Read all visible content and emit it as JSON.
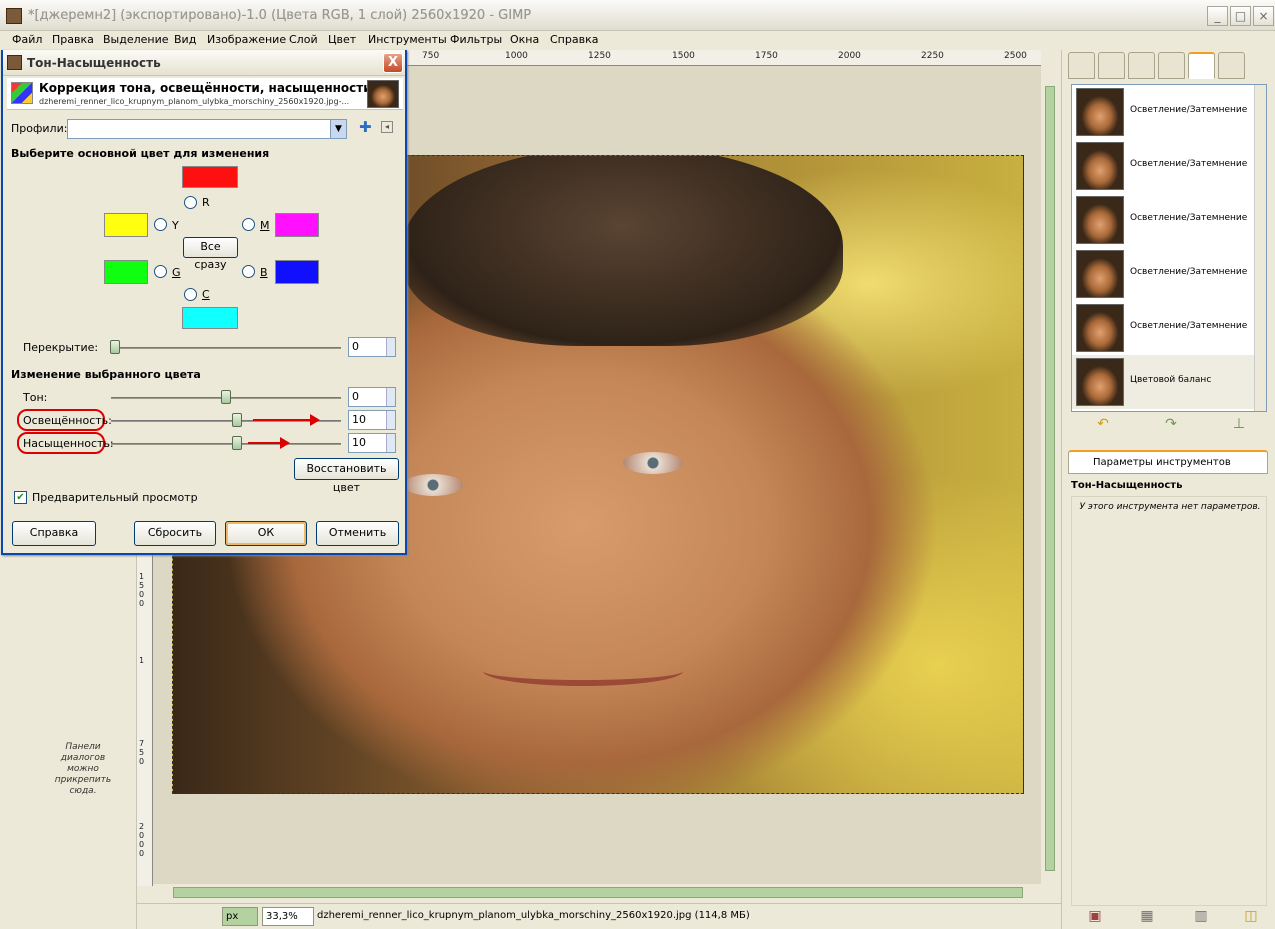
{
  "window": {
    "title": "*[джеремн2] (экспортировано)-1.0 (Цвета RGB, 1 слой) 2560x1920 - GIMP",
    "minimize": "_",
    "maximize": "□",
    "close": "×"
  },
  "menu": [
    "Файл",
    "Правка",
    "Выделение",
    "Вид",
    "Изображение",
    "Слой",
    "Цвет",
    "Инструменты",
    "Фильтры",
    "Окна",
    "Справка"
  ],
  "ruler_top": [
    "750",
    "1000",
    "1250",
    "1500",
    "1750",
    "2000",
    "2250",
    "2500"
  ],
  "ruler_left": [
    "1",
    "5",
    "0",
    "0",
    "1",
    "7",
    "5",
    "0",
    "2",
    "0",
    "0",
    "0"
  ],
  "left_dock_note": "Панели диалогов можно прикрепить сюда.",
  "status": {
    "unit": "px",
    "zoom": "33,3%",
    "file": "dzheremi_renner_lico_krupnym_planom_ulybka_morschiny_2560x1920.jpg (114,8 МБ)"
  },
  "history": {
    "items": [
      "Осветление/Затемнение",
      "Осветление/Затемнение",
      "Осветление/Затемнение",
      "Осветление/Затемнение",
      "Осветление/Затемнение",
      "Цветовой баланс"
    ]
  },
  "tool_options": {
    "tab_label": "Параметры инструментов",
    "tool_name": "Тон-Насыщенность",
    "note": "У этого инструмента нет параметров."
  },
  "dialog": {
    "title": "Тон-Насыщенность",
    "close": "X",
    "header_title": "Коррекция тона, освещённости, насыщенности",
    "header_file": "dzheremi_renner_lico_krupnym_planom_ulybka_morschiny_2560x1920.jpg-...",
    "profiles_label": "Профили:",
    "profiles_value": "",
    "add": "✚",
    "menu_arrow": "◂",
    "select_color_heading": "Выберите основной цвет для изменения",
    "colors": {
      "R": {
        "label": "R",
        "hex": "#ff1010"
      },
      "Y": {
        "label": "Y",
        "hex": "#ffff10"
      },
      "M": {
        "label": "M",
        "hex": "#ff10ff"
      },
      "G": {
        "label": "G",
        "hex": "#10ff10"
      },
      "B": {
        "label": "B",
        "hex": "#1010ff"
      },
      "C": {
        "label": "C",
        "hex": "#10ffff"
      }
    },
    "all_button": "Все сразу",
    "overlap_label": "Перекрытие:",
    "overlap_value": "0",
    "edit_heading": "Изменение выбранного цвета",
    "hue_label": "Тон:",
    "hue_value": "0",
    "lightness_label": "Освещённость:",
    "lightness_value": "10",
    "saturation_label": "Насыщенность:",
    "saturation_value": "10",
    "reset_color": "Восстановить цвет",
    "preview_label": "Предварительный просмотр",
    "preview_checked": "✔",
    "btn_help": "Справка",
    "btn_reset": "Сбросить",
    "btn_ok": "ОК",
    "btn_cancel": "Отменить"
  }
}
